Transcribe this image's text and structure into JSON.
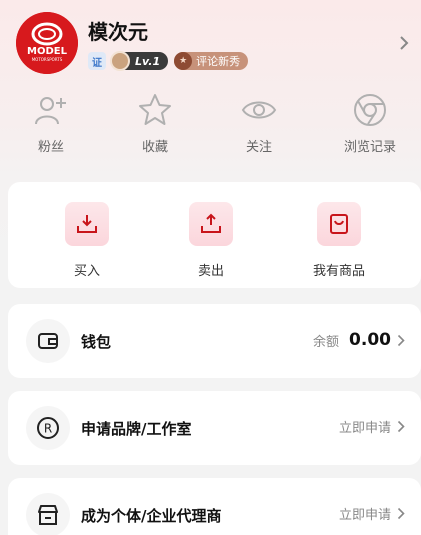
{
  "profile": {
    "avatar_logo_text": "MODEL",
    "avatar_sub_text": "MOTORSPORTS",
    "username": "模次元",
    "verify_badge": "证",
    "level_badge": "Lv.1",
    "review_badge": "评论新秀"
  },
  "quick_links": [
    {
      "label": "粉丝",
      "icon": "add-user-icon"
    },
    {
      "label": "收藏",
      "icon": "star-icon"
    },
    {
      "label": "关注",
      "icon": "eye-icon"
    },
    {
      "label": "浏览记录",
      "icon": "browser-history-icon"
    }
  ],
  "trade_actions": [
    {
      "label": "买入",
      "icon": "download-tray-icon"
    },
    {
      "label": "卖出",
      "icon": "upload-tray-icon"
    },
    {
      "label": "我有商品",
      "icon": "product-box-icon"
    }
  ],
  "wallet": {
    "title": "钱包",
    "balance_label": "余额",
    "balance_value": "0.00"
  },
  "brand_apply": {
    "title": "申请品牌/工作室",
    "action": "立即申请"
  },
  "agent_apply": {
    "title": "成为个体/企业代理商",
    "action": "立即申请"
  },
  "colors": {
    "accent": "#d7191d",
    "trade_icon_bg": "#fbd6dc"
  }
}
